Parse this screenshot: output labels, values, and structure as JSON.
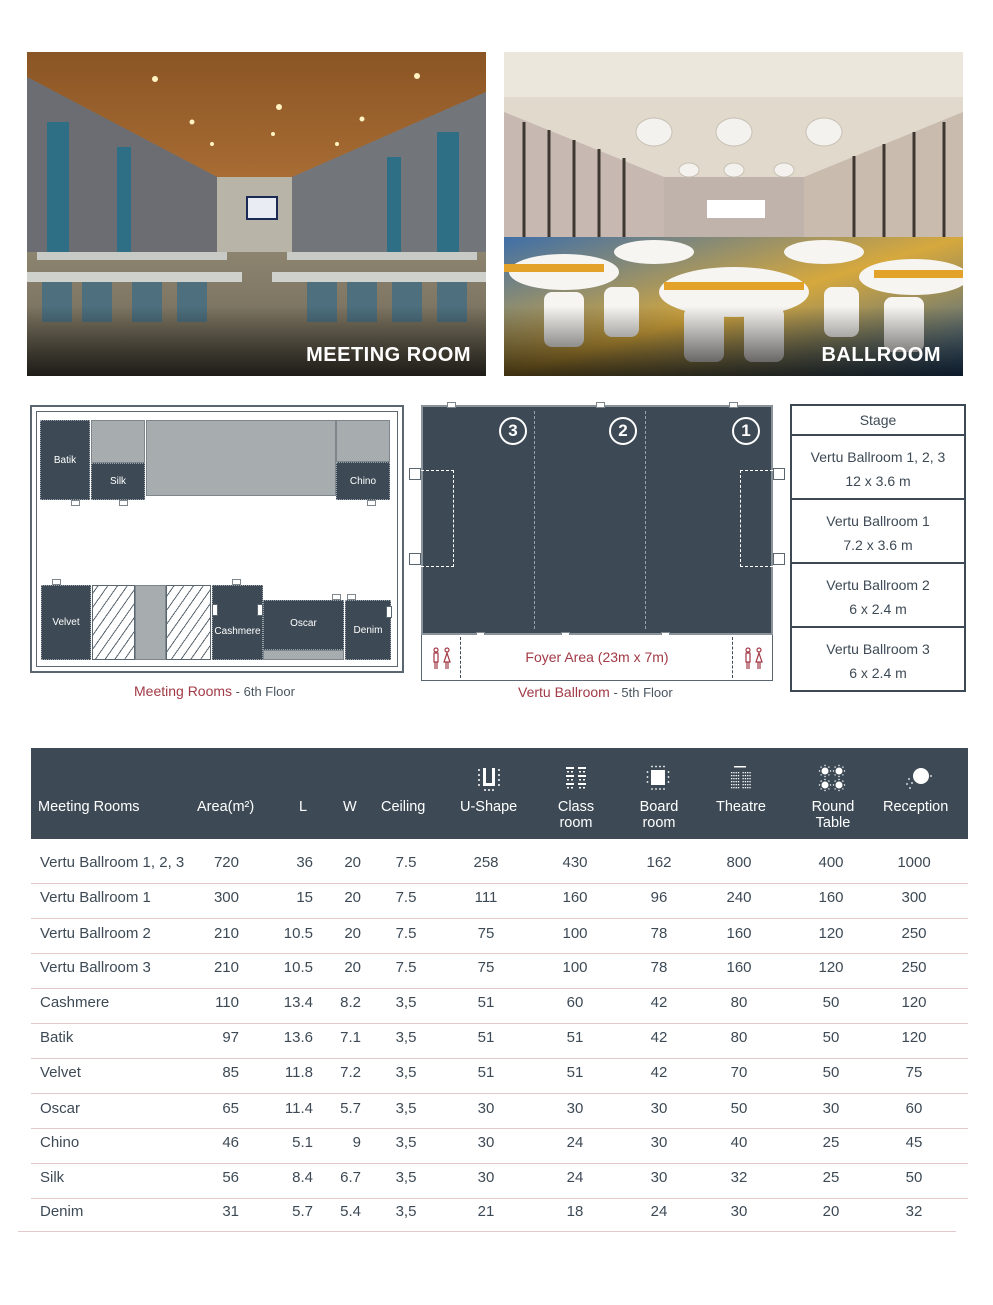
{
  "photos": {
    "meeting": {
      "caption": "MEETING ROOM"
    },
    "ballroom": {
      "caption": "BALLROOM"
    }
  },
  "meeting_plan": {
    "rooms": [
      "Batik",
      "Silk",
      "Chino",
      "Velvet",
      "Cashmere",
      "Oscar",
      "Denim"
    ],
    "label_main": "Meeting Rooms",
    "label_floor": " - 6th Floor"
  },
  "ballroom_plan": {
    "section_numbers": [
      "3",
      "2",
      "1"
    ],
    "foyer": "Foyer Area (23m x 7m)",
    "restroom_icon": "🚻",
    "label_main": "Vertu Ballroom",
    "label_floor": " - 5th Floor"
  },
  "stage": {
    "title": "Stage",
    "items": [
      {
        "name": "Vertu Ballroom 1, 2, 3",
        "size": "12 x 3.6 m"
      },
      {
        "name": "Vertu Ballroom 1",
        "size": "7.2 x 3.6 m"
      },
      {
        "name": "Vertu Ballroom 2",
        "size": "6 x 2.4 m"
      },
      {
        "name": "Vertu Ballroom 3",
        "size": "6 x 2.4 m"
      }
    ]
  },
  "capacity": {
    "headers": {
      "name": "Meeting Rooms",
      "area": "Area(m²)",
      "l": "L",
      "w": "W",
      "ceiling": "Ceiling",
      "ushape": "U-Shape",
      "class_1": "Class",
      "class_2": "room",
      "board_1": "Board",
      "board_2": "room",
      "theatre": "Theatre",
      "round_1": "Round",
      "round_2": "Table",
      "reception": "Reception"
    },
    "header_icons": [
      "u-shape-icon",
      "classroom-icon",
      "boardroom-icon",
      "theatre-icon",
      "round-table-icon",
      "reception-icon"
    ],
    "rows": [
      {
        "name": "Vertu Ballroom 1, 2, 3",
        "area": "720",
        "l": "36",
        "w": "20",
        "ceiling": "7.5",
        "ushape": "258",
        "classroom": "430",
        "boardroom": "162",
        "theatre": "800",
        "round": "400",
        "reception": "1000"
      },
      {
        "name": "Vertu Ballroom 1",
        "area": "300",
        "l": "15",
        "w": "20",
        "ceiling": "7.5",
        "ushape": "111",
        "classroom": "160",
        "boardroom": "96",
        "theatre": "240",
        "round": "160",
        "reception": "300"
      },
      {
        "name": "Vertu Ballroom 2",
        "area": "210",
        "l": "10.5",
        "w": "20",
        "ceiling": "7.5",
        "ushape": "75",
        "classroom": "100",
        "boardroom": "78",
        "theatre": "160",
        "round": "120",
        "reception": "250"
      },
      {
        "name": "Vertu Ballroom 3",
        "area": "210",
        "l": "10.5",
        "w": "20",
        "ceiling": "7.5",
        "ushape": "75",
        "classroom": "100",
        "boardroom": "78",
        "theatre": "160",
        "round": "120",
        "reception": "250"
      },
      {
        "name": "Cashmere",
        "area": "110",
        "l": "13.4",
        "w": "8.2",
        "ceiling": "3,5",
        "ushape": "51",
        "classroom": "60",
        "boardroom": "42",
        "theatre": "80",
        "round": "50",
        "reception": "120"
      },
      {
        "name": "Batik",
        "area": "97",
        "l": "13.6",
        "w": "7.1",
        "ceiling": "3,5",
        "ushape": "51",
        "classroom": "51",
        "boardroom": "42",
        "theatre": "80",
        "round": "50",
        "reception": "120"
      },
      {
        "name": "Velvet",
        "area": "85",
        "l": "11.8",
        "w": "7.2",
        "ceiling": "3,5",
        "ushape": "51",
        "classroom": "51",
        "boardroom": "42",
        "theatre": "70",
        "round": "50",
        "reception": "75"
      },
      {
        "name": "Oscar",
        "area": "65",
        "l": "11.4",
        "w": "5.7",
        "ceiling": "3,5",
        "ushape": "30",
        "classroom": "30",
        "boardroom": "30",
        "theatre": "50",
        "round": "30",
        "reception": "60"
      },
      {
        "name": "Chino",
        "area": "46",
        "l": "5.1",
        "w": "9",
        "ceiling": "3,5",
        "ushape": "30",
        "classroom": "24",
        "boardroom": "30",
        "theatre": "40",
        "round": "25",
        "reception": "45"
      },
      {
        "name": "Silk",
        "area": "56",
        "l": "8.4",
        "w": "6.7",
        "ceiling": "3,5",
        "ushape": "30",
        "classroom": "24",
        "boardroom": "30",
        "theatre": "32",
        "round": "25",
        "reception": "50"
      },
      {
        "name": "Denim",
        "area": "31",
        "l": "5.7",
        "w": "5.4",
        "ceiling": "3,5",
        "ushape": "21",
        "classroom": "18",
        "boardroom": "24",
        "theatre": "30",
        "round": "20",
        "reception": "32"
      }
    ]
  },
  "colors": {
    "primary_dark": "#3d4a55",
    "accent_red": "#a13a46",
    "row_divider": "#e3c8cb",
    "plan_grey": "#a7acaf"
  }
}
